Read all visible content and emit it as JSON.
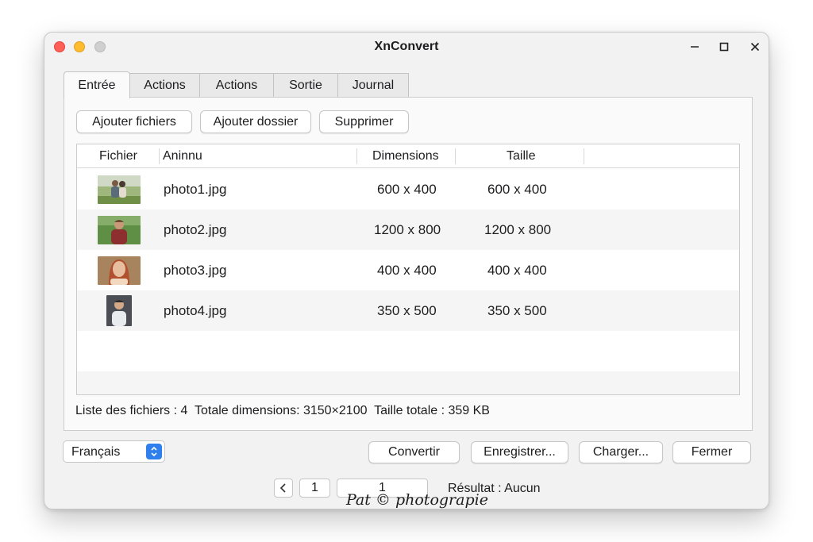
{
  "window": {
    "title": "XnConvert"
  },
  "tabs": [
    {
      "label": "Entrée",
      "active": true
    },
    {
      "label": "Actions"
    },
    {
      "label": "Actions"
    },
    {
      "label": "Sortie"
    },
    {
      "label": "Journal"
    }
  ],
  "toolbar": {
    "add_files": "Ajouter fichiers",
    "add_folder": "Ajouter dossier",
    "remove": "Supprimer"
  },
  "table": {
    "columns": [
      "Fichier",
      "Aninnu",
      "Dimensions",
      "Taille"
    ],
    "rows": [
      {
        "name": "photo1.jpg",
        "dimensions": "600 x 400",
        "size": "600 x 400",
        "thumb": "couple-outdoor"
      },
      {
        "name": "photo2.jpg",
        "dimensions": "1200 x 800",
        "size": "1200 x 800",
        "thumb": "person-park"
      },
      {
        "name": "photo3.jpg",
        "dimensions": "400 x 400",
        "size": "400 x 400",
        "thumb": "woman-portrait"
      },
      {
        "name": "photo4.jpg",
        "dimensions": "350 x 500",
        "size": "350 x 500",
        "thumb": "man-portrait"
      }
    ]
  },
  "status": {
    "text": "Liste des fichiers : 4  Totale dimensions: 3150×2100  Taille totale : 359 KB"
  },
  "language": {
    "selected": "Français"
  },
  "actions": {
    "convert": "Convertir",
    "save": "Enregistrer...",
    "load": "Charger...",
    "close": "Fermer"
  },
  "pager": {
    "page": "1",
    "field": "1"
  },
  "result": "Résultat : Aucun",
  "watermark": "Pat © photograpie",
  "colors": {
    "accent": "#2f80ed",
    "close": "#fe5f57",
    "minimize": "#febc2e"
  }
}
